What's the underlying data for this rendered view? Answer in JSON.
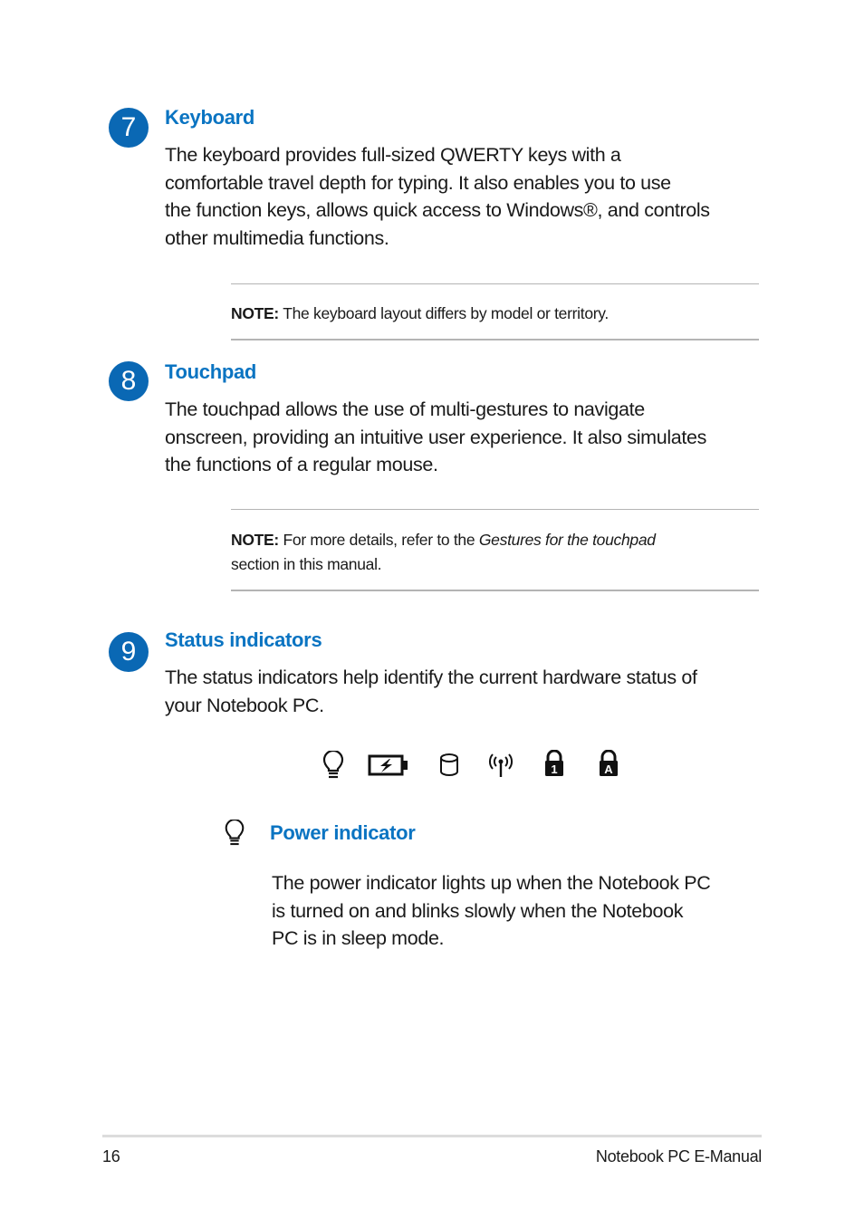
{
  "sections": [
    {
      "number": "7",
      "title": "Keyboard",
      "body": "The keyboard provides full-sized QWERTY keys with a comfortable travel depth for typing. It also enables you to use the function keys, allows quick access to Windows®, and controls other multimedia functions.",
      "body_lines": [
        "The keyboard provides full-sized QWERTY keys with a",
        "comfortable travel depth for typing. It also enables you to use",
        "the function keys, allows quick access to Windows®, and controls",
        "other multimedia functions."
      ],
      "note": {
        "label": "NOTE:",
        "text": " The keyboard layout differs by model or territory."
      }
    },
    {
      "number": "8",
      "title": "Touchpad",
      "body_lines": [
        "The touchpad allows the use of multi-gestures to navigate",
        "onscreen, providing an intuitive user experience. It also simulates",
        "the functions of a regular mouse."
      ],
      "note": {
        "label": "NOTE:",
        "text_before": " For more details, refer to the ",
        "italic": "Gestures for the touchpad",
        "text_after": "section in this manual."
      }
    },
    {
      "number": "9",
      "title": "Status indicators",
      "body_lines": [
        "The status indicators help identify the current hardware status of",
        "your Notebook PC."
      ],
      "indicator_icons": [
        "power-bulb-icon",
        "battery-charging-icon",
        "drive-activity-icon",
        "wireless-icon",
        "num-lock-icon",
        "caps-lock-icon"
      ],
      "num_lock_char": "1",
      "caps_lock_char": "A"
    }
  ],
  "power_indicator": {
    "title": "Power indicator",
    "body_lines": [
      "The power indicator lights up when the Notebook PC",
      "is turned on and blinks slowly when the Notebook",
      "PC is in sleep mode."
    ]
  },
  "footer": {
    "page_number": "16",
    "manual_title": "Notebook PC E-Manual"
  },
  "colors": {
    "accent": "#0a74c2",
    "badge": "#0a68b4",
    "rule": "#b4b4b4"
  }
}
